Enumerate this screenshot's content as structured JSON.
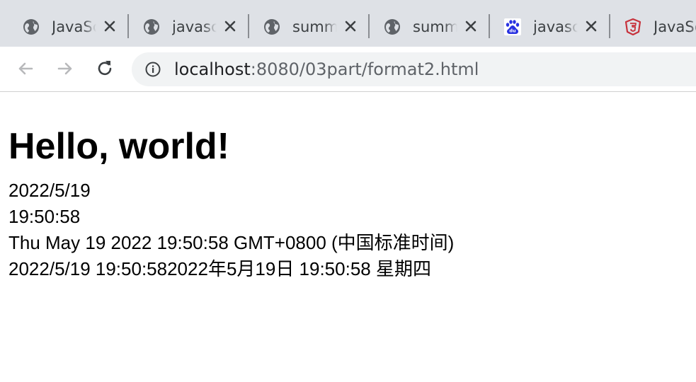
{
  "browser": {
    "tabs": [
      {
        "title": "JavaScript",
        "favicon": "globe-icon"
      },
      {
        "title": "javascript",
        "favicon": "globe-icon"
      },
      {
        "title": "summary",
        "favicon": "globe-icon"
      },
      {
        "title": "summary",
        "favicon": "globe-icon"
      },
      {
        "title": "javascript",
        "favicon": "baidu-icon"
      },
      {
        "title": "JavaScript",
        "favicon": "html5-icon"
      }
    ],
    "address": {
      "host": "localhost",
      "rest": ":8080/03part/format2.html"
    }
  },
  "page": {
    "heading": "Hello, world!",
    "lines": [
      "2022/5/19",
      "19:50:58",
      "Thu May 19 2022 19:50:58 GMT+0800 (中国标准时间)",
      "2022/5/19 19:50:582022年5月19日 19:50:58 星期四"
    ]
  },
  "colors": {
    "tabstrip": "#dee1e6",
    "omnibox": "#f1f3f4",
    "baidu_blue": "#2932e1",
    "html5_red": "#c7323c"
  }
}
